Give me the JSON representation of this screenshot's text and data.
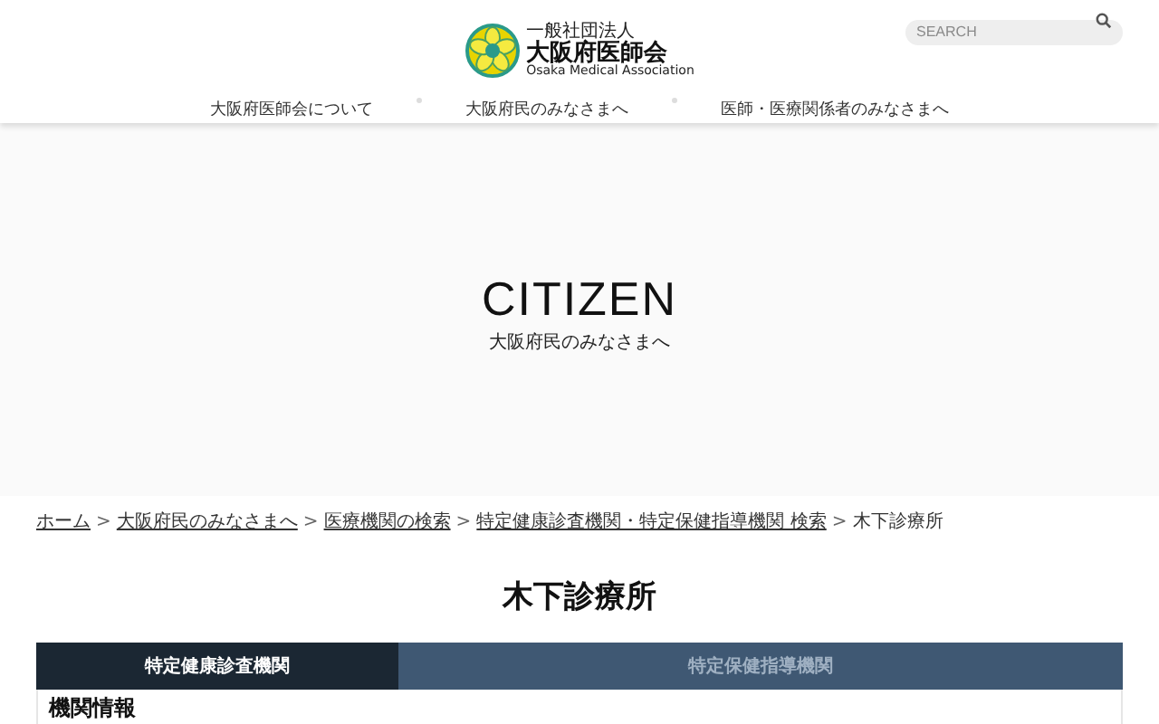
{
  "header": {
    "logo": {
      "kicker": "一般社団法人",
      "name": "大阪府医師会",
      "english": "Osaka Medical Association"
    },
    "search": {
      "placeholder": "SEARCH"
    },
    "nav": [
      "大阪府医師会について",
      "大阪府民のみなさまへ",
      "医師・医療関係者のみなさまへ"
    ]
  },
  "hero": {
    "title": "CITIZEN",
    "subtitle": "大阪府民のみなさまへ"
  },
  "breadcrumb_separator": ">",
  "breadcrumb": [
    {
      "label": "ホーム",
      "link": true
    },
    {
      "label": "大阪府民のみなさまへ",
      "link": true
    },
    {
      "label": "医療機関の検索",
      "link": true
    },
    {
      "label": "特定健康診査機関・特定保健指導機関 検索",
      "link": true
    },
    {
      "label": "木下診療所",
      "link": false
    }
  ],
  "page_title": "木下診療所",
  "tabs": [
    {
      "label": "特定健康診査機関",
      "selected": true
    },
    {
      "label": "特定保健指導機関",
      "selected": false
    }
  ],
  "section_heading": "機関情報"
}
